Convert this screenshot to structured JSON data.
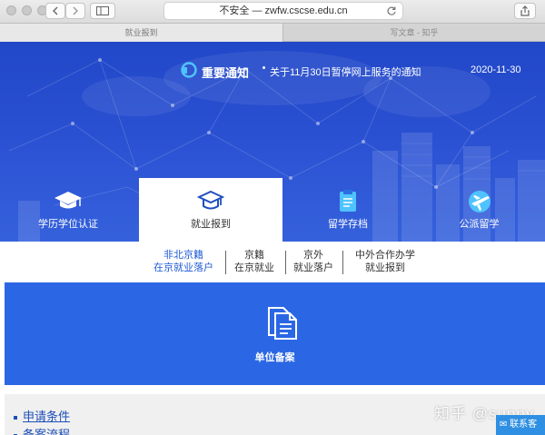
{
  "browser": {
    "address": "不安全 — zwfw.cscse.edu.cn",
    "tabs": [
      {
        "label": "就业报到",
        "active": true
      },
      {
        "label": "写文章 - 知乎",
        "active": false
      }
    ]
  },
  "notice": {
    "title": "重要通知",
    "text": "关于11月30日暂停网上服务的通知",
    "date": "2020-11-30"
  },
  "services": [
    {
      "label": "学历学位认证",
      "icon": "graduation-cap-icon",
      "active": false
    },
    {
      "label": "就业报到",
      "icon": "mortarboard-outline-icon",
      "active": true
    },
    {
      "label": "留学存档",
      "icon": "archive-icon",
      "active": false
    },
    {
      "label": "公派留学",
      "icon": "airplane-icon",
      "active": false
    }
  ],
  "subtabs": [
    {
      "line1": "非北京籍",
      "line2": "在京就业落户",
      "active": true
    },
    {
      "line1": "京籍",
      "line2": "在京就业",
      "active": false
    },
    {
      "line1": "京外",
      "line2": "就业落户",
      "active": false
    },
    {
      "line1": "中外合作办学",
      "line2": "就业报到",
      "active": false
    }
  ],
  "unit_panel": {
    "label": "单位备案",
    "icon": "documents-icon"
  },
  "links": [
    "申请条件",
    "备案流程"
  ],
  "watermark": "知乎 @sunny",
  "contact": "联系客",
  "colors": {
    "banner": "#2a50d2",
    "panel": "#2b67e4",
    "accent": "#1f5ad6"
  }
}
